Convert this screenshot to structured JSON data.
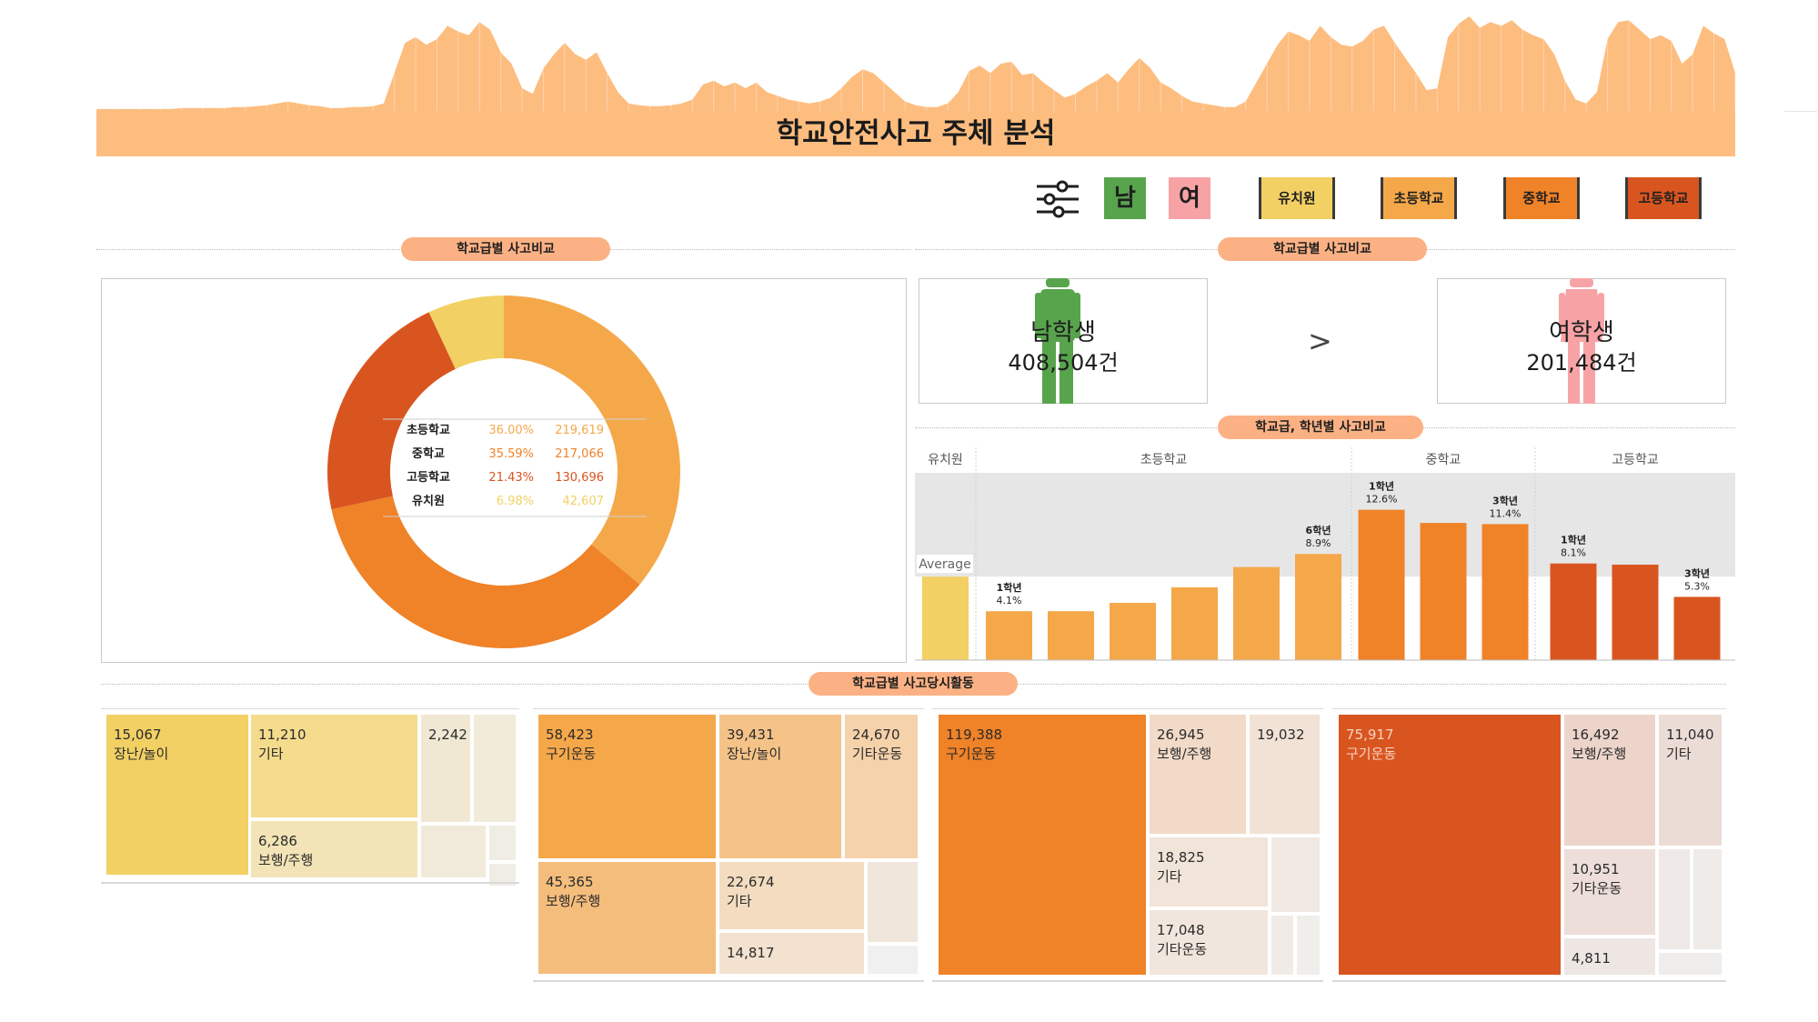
{
  "page": {
    "title": "학교안전사고 주체 분석"
  },
  "filters": {
    "gender": [
      {
        "label": "남",
        "color": "#58a44d"
      },
      {
        "label": "여",
        "color": "#f7a3a6"
      }
    ],
    "levels": [
      {
        "label": "유치원",
        "color": "#f2d064"
      },
      {
        "label": "초등학교",
        "color": "#f5a84a"
      },
      {
        "label": "중학교",
        "color": "#f08228"
      },
      {
        "label": "고등학교",
        "color": "#d95520"
      }
    ]
  },
  "sections": {
    "donut_title": "학교급별 사고비교",
    "gender_title": "학교급별 사고비교",
    "grade_title": "학교급, 학년별 사고비교",
    "activity_title": "학교급별 사고당시활동"
  },
  "gender": {
    "male": {
      "label": "남학생",
      "value": "408,504건",
      "color": "#58a44d"
    },
    "female": {
      "label": "여학생",
      "value": "201,484건",
      "color": "#f7a3a6"
    },
    "compare": ">"
  },
  "chart_data": [
    {
      "type": "area",
      "name": "top-sparkline",
      "color": "#fdbd7f",
      "values": [
        2,
        2,
        2,
        2,
        2,
        2,
        2,
        2,
        3,
        3,
        3,
        3,
        3,
        4,
        4,
        5,
        6,
        8,
        10,
        8,
        6,
        5,
        3,
        3,
        4,
        4,
        5,
        8,
        40,
        72,
        78,
        70,
        76,
        90,
        84,
        80,
        94,
        86,
        62,
        50,
        24,
        18,
        45,
        60,
        72,
        60,
        54,
        62,
        40,
        20,
        8,
        6,
        5,
        5,
        6,
        8,
        12,
        28,
        32,
        26,
        30,
        24,
        30,
        20,
        16,
        12,
        10,
        8,
        10,
        14,
        24,
        36,
        44,
        40,
        30,
        20,
        10,
        6,
        4,
        4,
        8,
        20,
        42,
        48,
        40,
        50,
        52,
        38,
        40,
        30,
        22,
        14,
        18,
        26,
        32,
        40,
        30,
        44,
        56,
        46,
        30,
        24,
        16,
        10,
        8,
        6,
        4,
        4,
        10,
        30,
        50,
        70,
        84,
        80,
        74,
        90,
        78,
        70,
        68,
        74,
        86,
        90,
        72,
        56,
        40,
        22,
        24,
        78,
        92,
        100,
        88,
        94,
        90,
        96,
        86,
        80,
        76,
        60,
        32,
        12,
        8,
        20,
        76,
        94,
        96,
        86,
        76,
        80,
        74,
        50,
        60,
        90,
        82,
        76,
        40
      ]
    },
    {
      "type": "pie",
      "name": "school-level-donut",
      "categories": [
        "초등학교",
        "중학교",
        "고등학교",
        "유치원"
      ],
      "percent_labels": [
        "36.00%",
        "35.59%",
        "21.43%",
        "6.98%"
      ],
      "value_labels": [
        "219,619",
        "217,066",
        "130,696",
        "42,607"
      ],
      "values": [
        219619,
        217066,
        130696,
        42607
      ],
      "colors": [
        "#f5a84a",
        "#f08228",
        "#d95520",
        "#f2d064"
      ]
    },
    {
      "type": "bar",
      "name": "grade-bar-chart",
      "groups": [
        {
          "name": "유치원",
          "color": "#f2d064",
          "bars": [
            {
              "value": 7.0,
              "label": "",
              "pct": "7.0%"
            }
          ]
        },
        {
          "name": "초등학교",
          "color": "#f5a84a",
          "bars": [
            {
              "value": 4.1,
              "label": "1학년",
              "pct": "4.1%"
            },
            {
              "value": 4.1,
              "label": "",
              "pct": ""
            },
            {
              "value": 4.8,
              "label": "",
              "pct": ""
            },
            {
              "value": 6.1,
              "label": "",
              "pct": ""
            },
            {
              "value": 7.8,
              "label": "",
              "pct": ""
            },
            {
              "value": 8.9,
              "label": "6학년",
              "pct": "8.9%"
            }
          ]
        },
        {
          "name": "중학교",
          "color": "#f08228",
          "bars": [
            {
              "value": 12.6,
              "label": "1학년",
              "pct": "12.6%"
            },
            {
              "value": 11.5,
              "label": "",
              "pct": ""
            },
            {
              "value": 11.4,
              "label": "3학년",
              "pct": "11.4%"
            }
          ]
        },
        {
          "name": "고등학교",
          "color": "#d95520",
          "bars": [
            {
              "value": 8.1,
              "label": "1학년",
              "pct": "8.1%"
            },
            {
              "value": 8.0,
              "label": "",
              "pct": ""
            },
            {
              "value": 5.3,
              "label": "3학년",
              "pct": "5.3%"
            }
          ]
        }
      ],
      "reference_line": {
        "label": "Average",
        "value": 7.0
      },
      "band": {
        "from": 7.0,
        "to": 15.7
      },
      "ylim": [
        0,
        15.7
      ]
    },
    {
      "type": "treemap",
      "name": "activity-treemaps",
      "panels": [
        {
          "level": "유치원",
          "cells": [
            {
              "value": "15,067",
              "label": "장난/놀이",
              "color": "#f2d064"
            },
            {
              "value": "11,210",
              "label": "기타",
              "color": "#f4dc8c"
            },
            {
              "value": "6,286",
              "label": "보행/주행",
              "color": "#f2e4b6"
            },
            {
              "value": "2,242",
              "label": "",
              "color": "#f0e8d3"
            },
            {
              "value": "",
              "label": "",
              "color": "#f1ebda"
            },
            {
              "value": "",
              "label": "",
              "color": "#f1eadb"
            },
            {
              "value": "",
              "label": "",
              "color": "#f0ede4"
            },
            {
              "value": "",
              "label": "",
              "color": "#f0ede6"
            }
          ]
        },
        {
          "level": "초등학교",
          "cells": [
            {
              "value": "58,423",
              "label": "구기운동",
              "color": "#f5a84a"
            },
            {
              "value": "39,431",
              "label": "장난/놀이",
              "color": "#f5c388"
            },
            {
              "value": "24,670",
              "label": "기타운동",
              "color": "#f5d2aa"
            },
            {
              "value": "45,365",
              "label": "보행/주행",
              "color": "#f5bd7c"
            },
            {
              "value": "22,674",
              "label": "기타",
              "color": "#f3dcc0"
            },
            {
              "value": "14,817",
              "label": "",
              "color": "#f2e2cf"
            },
            {
              "value": "",
              "label": "",
              "color": "#f0e6dc"
            },
            {
              "value": "",
              "label": "",
              "color": "#f0f0f0"
            }
          ]
        },
        {
          "level": "중학교",
          "cells": [
            {
              "value": "119,388",
              "label": "구기운동",
              "color": "#f08228"
            },
            {
              "value": "26,945",
              "label": "보행/주행",
              "color": "#f2dac8"
            },
            {
              "value": "19,032",
              "label": "",
              "color": "#f2e2d6"
            },
            {
              "value": "18,825",
              "label": "기타",
              "color": "#f1e4d9"
            },
            {
              "value": "17,048",
              "label": "기타운동",
              "color": "#f1e6dd"
            },
            {
              "value": "",
              "label": "",
              "color": "#f0e9e3"
            },
            {
              "value": "",
              "label": "",
              "color": "#f0ebe6"
            },
            {
              "value": "",
              "label": "",
              "color": "#f0eeeb"
            }
          ]
        },
        {
          "level": "고등학교",
          "cells": [
            {
              "value": "75,917",
              "label": "구기운동",
              "color": "#d95520"
            },
            {
              "value": "16,492",
              "label": "보행/주행",
              "color": "#ecd4cb"
            },
            {
              "value": "11,040",
              "label": "기타",
              "color": "#ecdcd6"
            },
            {
              "value": "10,951",
              "label": "기타운동",
              "color": "#eddeda"
            },
            {
              "value": "4,811",
              "label": "",
              "color": "#eee6e3"
            },
            {
              "value": "",
              "label": "",
              "color": "#eee9e7"
            },
            {
              "value": "",
              "label": "",
              "color": "#eeebe9"
            },
            {
              "value": "",
              "label": "",
              "color": "#efedec"
            }
          ]
        }
      ]
    }
  ]
}
